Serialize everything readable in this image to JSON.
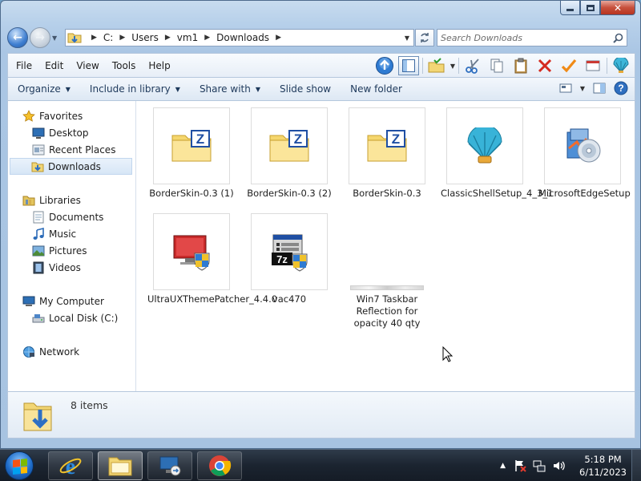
{
  "window": {
    "close_glyph": "✕"
  },
  "nav": {
    "back_glyph": "←",
    "forward_glyph": "→",
    "address_segments": [
      "C:",
      "Users",
      "vm1",
      "Downloads"
    ],
    "search_placeholder": "Search Downloads"
  },
  "menu": {
    "items": [
      "File",
      "Edit",
      "View",
      "Tools",
      "Help"
    ]
  },
  "commands": {
    "organize": "Organize",
    "include_in_library": "Include in library",
    "share_with": "Share with",
    "slide_show": "Slide show",
    "new_folder": "New folder"
  },
  "navpane": {
    "favorites": "Favorites",
    "desktop": "Desktop",
    "recent_places": "Recent Places",
    "downloads": "Downloads",
    "libraries": "Libraries",
    "documents": "Documents",
    "music": "Music",
    "pictures": "Pictures",
    "videos": "Videos",
    "my_computer": "My Computer",
    "local_disk": "Local Disk (C:)",
    "network": "Network"
  },
  "files": [
    {
      "name": "BorderSkin-0.3 (1)",
      "icon": "zip-folder-icon"
    },
    {
      "name": "BorderSkin-0.3 (2)",
      "icon": "zip-folder-icon"
    },
    {
      "name": "BorderSkin-0.3",
      "icon": "zip-folder-icon"
    },
    {
      "name": "ClassicShellSetup_4_3_1",
      "icon": "shell-icon"
    },
    {
      "name": "MicrosoftEdgeSetup",
      "icon": "installer-disc-icon"
    },
    {
      "name": "UltraUXThemePatcher_4.4.0",
      "icon": "theme-patcher-icon"
    },
    {
      "name": "vac470",
      "icon": "7z-installer-icon"
    },
    {
      "name": "Win7 Taskbar Reflection for opacity 40 qty",
      "icon": "image-thumbnail"
    }
  ],
  "details": {
    "count": "8 items"
  },
  "taskbar": {
    "time": "5:18 PM",
    "date": "6/11/2023",
    "tray_arrow": "▲"
  },
  "colors": {
    "accent": "#1e395b",
    "folder": "#f2d675"
  }
}
